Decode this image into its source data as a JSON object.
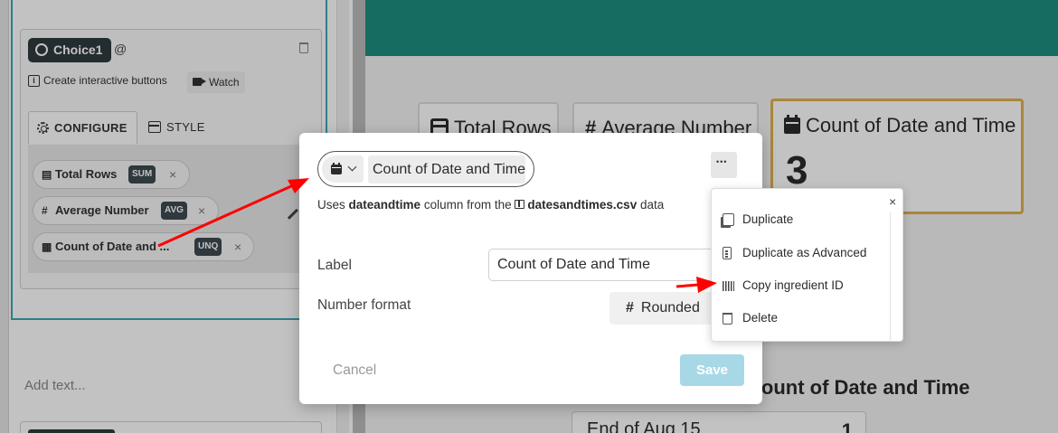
{
  "sidebar": {
    "block_chip": "Choice1",
    "at_sign": "@",
    "hint": "Create interactive buttons",
    "watch_label": "Watch",
    "tabs": {
      "configure": "CONFIGURE",
      "style": "STYLE"
    },
    "ingredients": [
      {
        "lead": "▤",
        "name": "Total Rows",
        "badge": "SUM"
      },
      {
        "lead": "#",
        "name": "Average Number",
        "badge": "AVG"
      },
      {
        "lead": "▦",
        "name": "Count of Date and ...",
        "badge": "UNQ"
      }
    ],
    "add_text_placeholder": "Add text..."
  },
  "canvas": {
    "tiles": [
      {
        "title": "Total Rows",
        "icon": "table-icon"
      },
      {
        "title": "Average Number",
        "icon": "hash-icon"
      },
      {
        "title": "Count of Date and Time",
        "value": "3",
        "icon": "calendar-icon"
      }
    ],
    "section_heading": "Count of Date and Time",
    "list_item": {
      "label": "End of Aug 15",
      "count": "1"
    }
  },
  "modal": {
    "ingredient_name": "Count of Date and Time",
    "uses_prefix": "Uses",
    "column_name": "dateandtime",
    "uses_middle": "column from the",
    "data_source": "datesandtimes.csv",
    "uses_suffix": "data",
    "label_field_label": "Label",
    "label_value": "Count of Date and Time",
    "number_format_label": "Number format",
    "number_format_value": "Rounded",
    "cancel_label": "Cancel",
    "save_label": "Save"
  },
  "context_menu": {
    "close": "×",
    "items": [
      "Duplicate",
      "Duplicate as Advanced",
      "Copy ingredient ID",
      "Delete"
    ]
  },
  "colors": {
    "banner": "#1e8f80",
    "selected_tile_border": "#e0b04f",
    "save_button": "#a7d8e6",
    "annotation_arrow": "#ff0000",
    "block_outline": "#3aa6b4"
  }
}
